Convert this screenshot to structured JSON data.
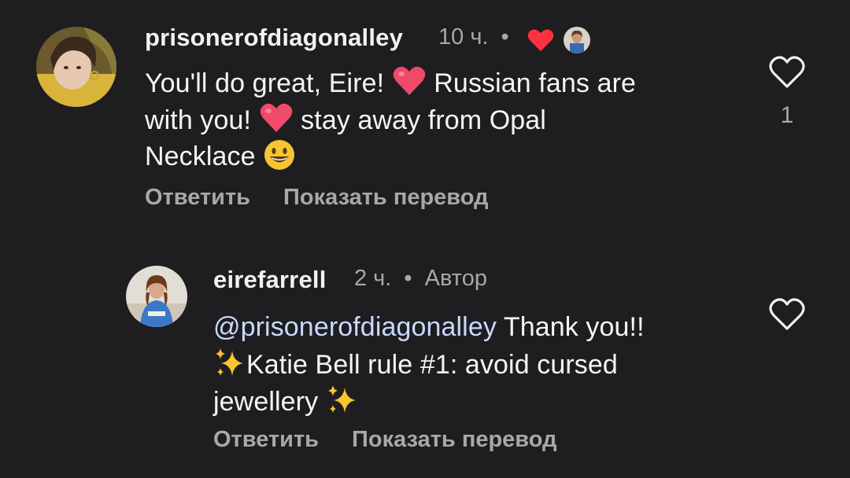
{
  "comments": [
    {
      "username": "prisonerofdiagonalley",
      "time": "10 ч.",
      "dot": "•",
      "text_lines": [
        "You'll do great, Eire! ",
        " Russian fans are",
        "with you! ",
        " stay away from Opal",
        "Necklace "
      ],
      "actions": {
        "reply": "Ответить",
        "translate": "Показать перевод"
      },
      "like_count": "1",
      "icons": [
        "heart-emoji",
        "smiley-emoji",
        "liked-by-author-heart-icon",
        "author-mini-avatar",
        "like-heart-icon"
      ]
    },
    {
      "username": "eirefarrell",
      "time": "2 ч.",
      "dot": "•",
      "author_label": "Автор",
      "mention": "@prisonerofdiagonalley",
      "text_lines": [
        " Thank you!!",
        "Katie Bell rule #1: avoid cursed",
        "jewellery "
      ],
      "actions": {
        "reply": "Ответить",
        "translate": "Показать перевод"
      },
      "icons": [
        "sparkles-emoji",
        "like-heart-icon"
      ]
    }
  ],
  "colors": {
    "background": "#1e1e20",
    "text": "#f5f5f5",
    "secondary": "#a8a8aa",
    "like_red": "#ff3040",
    "mention": "#c9d8ff"
  }
}
